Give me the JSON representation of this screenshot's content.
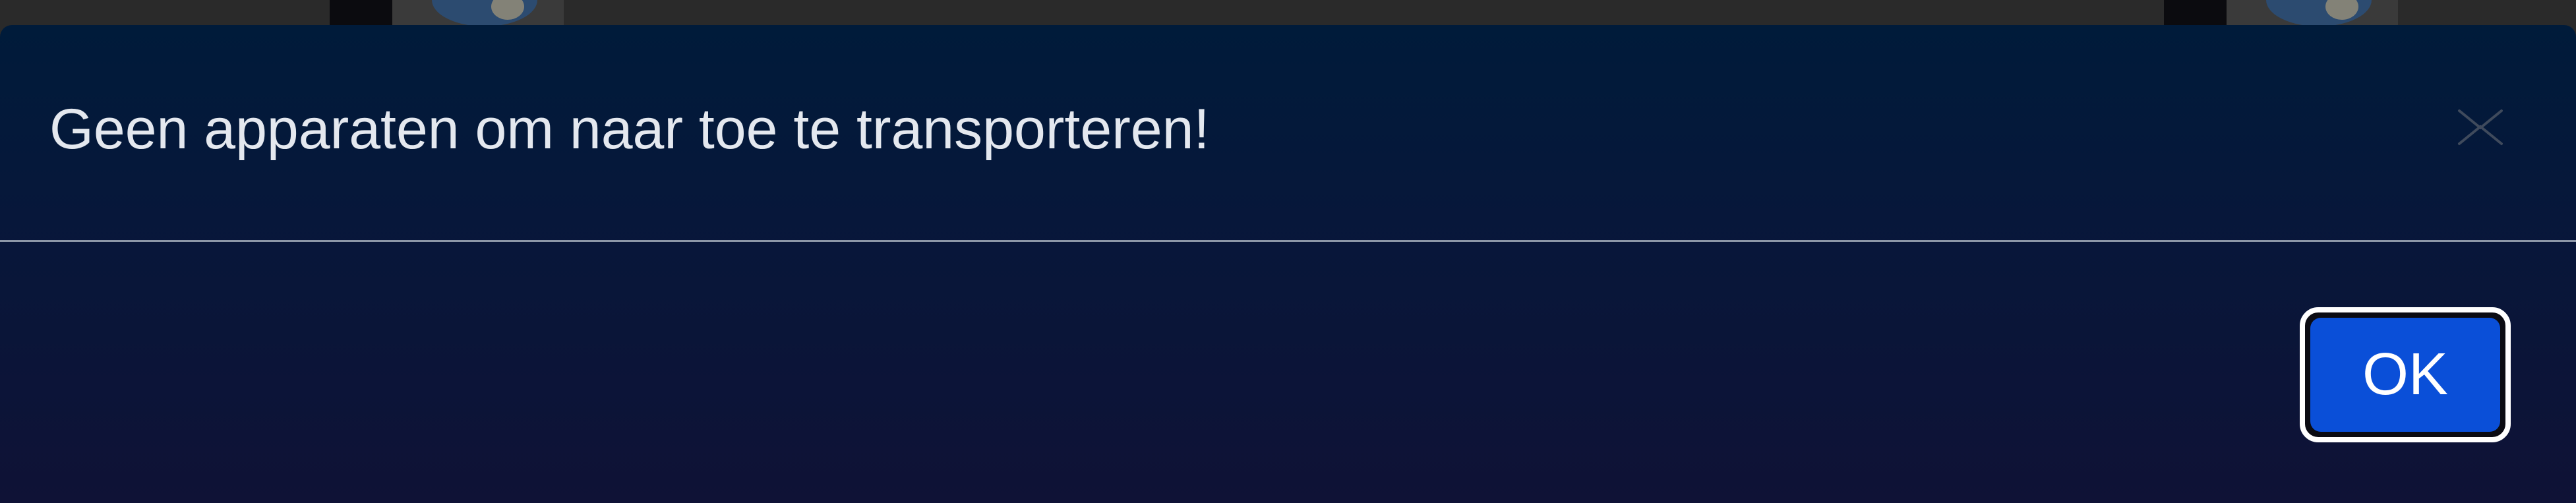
{
  "dialog": {
    "message": "Geen apparaten om naar toe te transporteren!",
    "ok_label": "OK",
    "close_icon": "close-icon"
  },
  "colors": {
    "dialog_top": "#001b3a",
    "dialog_bottom": "#0f1236",
    "message_text": "#e4e8ef",
    "ok_button": "#0a4fd8",
    "ok_border": "#ffffff",
    "divider": "#8d97a8"
  }
}
